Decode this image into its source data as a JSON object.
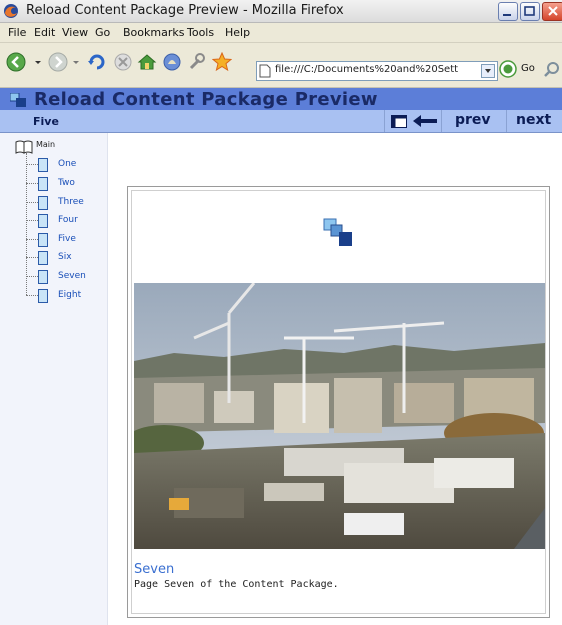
{
  "window": {
    "title": "Reload Content Package Preview - Mozilla Firefox"
  },
  "menu": [
    "File",
    "Edit",
    "View",
    "Go",
    "Bookmarks",
    "Tools",
    "Help"
  ],
  "address_bar": {
    "url": "file:///C:/Documents%20and%20Sett",
    "go_label": "Go"
  },
  "header": {
    "app_title": "Reload Content Package Preview",
    "current_item": "Five",
    "prev_label": "prev",
    "next_label": "next"
  },
  "tree": {
    "root_label": "Main",
    "items": [
      "One",
      "Two",
      "Three",
      "Four",
      "Five",
      "Six",
      "Seven",
      "Eight"
    ]
  },
  "content": {
    "title": "Seven",
    "description": "Page Seven of the Content Package."
  },
  "colors": {
    "header_bar": "#5c7ed8",
    "sub_bar": "#a9c1f2",
    "link": "#3a6fd0"
  }
}
